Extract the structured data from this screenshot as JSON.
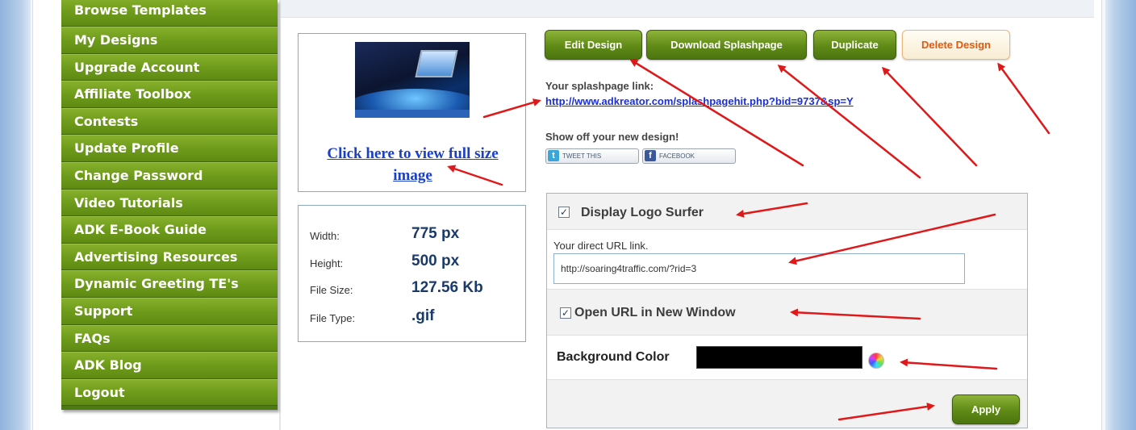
{
  "sidebar": {
    "items": [
      {
        "label": "Browse Templates"
      },
      {
        "label": "My Designs"
      },
      {
        "label": "Upgrade Account"
      },
      {
        "label": "Affiliate Toolbox"
      },
      {
        "label": "Contests"
      },
      {
        "label": "Update Profile"
      },
      {
        "label": "Change Password"
      },
      {
        "label": "Video Tutorials"
      },
      {
        "label": "ADK E-Book Guide"
      },
      {
        "label": "Advertising Resources"
      },
      {
        "label": "Dynamic Greeting TE's"
      },
      {
        "label": "Support"
      },
      {
        "label": "FAQs"
      },
      {
        "label": "ADK Blog"
      },
      {
        "label": "Logout"
      }
    ]
  },
  "preview": {
    "view_link": "Click here to view full size image"
  },
  "details": {
    "width_label": "Width:",
    "width_value": "775 px",
    "height_label": "Height:",
    "height_value": "500 px",
    "filesize_label": "File Size:",
    "filesize_value": "127.56 Kb",
    "filetype_label": "File Type:",
    "filetype_value": ".gif"
  },
  "actions": {
    "edit": "Edit Design",
    "download": "Download Splashpage",
    "duplicate": "Duplicate",
    "delete": "Delete Design"
  },
  "splash": {
    "link_label": "Your splashpage link:",
    "link_url": "http://www.adkreator.com/splashpagehit.php?bid=9737&sp=Y",
    "share_label": "Show off your new design!",
    "tweet_label": "TWEET THIS",
    "facebook_label": "FACEBOOK"
  },
  "settings": {
    "display_logo_label": "Display Logo Surfer",
    "display_logo_checked": true,
    "url_label": "Your direct URL link.",
    "url_value": "http://soaring4traffic.com/?rid=3",
    "new_window_label": "Open URL in New Window",
    "new_window_checked": true,
    "bg_color_label": "Background Color",
    "bg_color_value": "#000000",
    "apply_label": "Apply"
  },
  "colors": {
    "menu_green": "#6f9b1c",
    "button_green": "#5f8a16",
    "delete_text": "#e05a10",
    "link_blue": "#1a40c8",
    "annotation_arrow": "#e0181a"
  },
  "icons": [
    "twitter-icon",
    "facebook-icon",
    "checkbox-check-icon",
    "color-picker-icon"
  ]
}
